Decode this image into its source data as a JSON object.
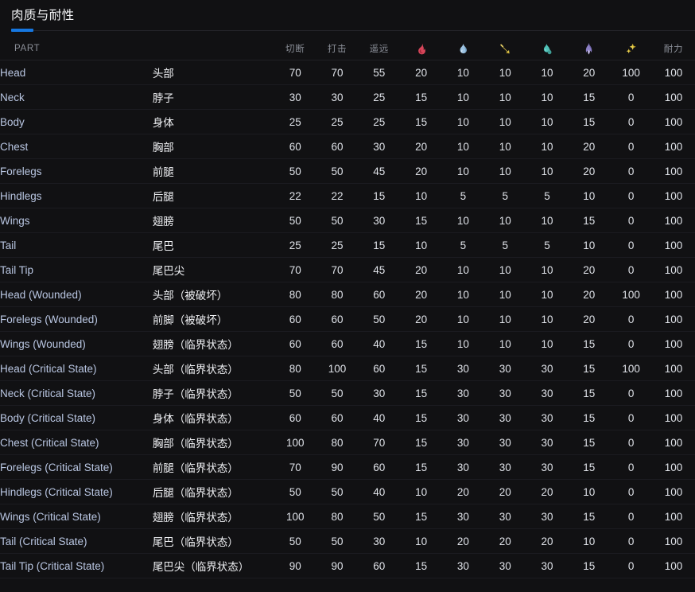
{
  "panel": {
    "title": "肉质与耐性",
    "accent_color": "#1677e0",
    "background_color": "#111113"
  },
  "table": {
    "headers": {
      "part": "PART",
      "part_cn": "",
      "sever": "切断",
      "blunt": "打击",
      "ranged": "遥远",
      "fire": "fire-icon",
      "water": "water-icon",
      "thunder": "thunder-icon",
      "ice": "ice-icon",
      "dragon": "dragon-icon",
      "blast": "blast-icon",
      "stamina": "耐力"
    },
    "element_colors": {
      "fire": "#d6465a",
      "water": "#8fb7d9",
      "thunder": "#e0c64a",
      "ice": "#4fc2b8",
      "dragon": "#8b7fc4",
      "blast": "#e8cf50"
    },
    "rows": [
      {
        "part": "Head",
        "part_cn": "头部",
        "sever": "70",
        "blunt": "70",
        "ranged": "55",
        "fire": "20",
        "water": "10",
        "thunder": "10",
        "ice": "10",
        "dragon": "20",
        "blast": "100",
        "stamina": "100"
      },
      {
        "part": "Neck",
        "part_cn": "脖子",
        "sever": "30",
        "blunt": "30",
        "ranged": "25",
        "fire": "15",
        "water": "10",
        "thunder": "10",
        "ice": "10",
        "dragon": "15",
        "blast": "0",
        "stamina": "100"
      },
      {
        "part": "Body",
        "part_cn": "身体",
        "sever": "25",
        "blunt": "25",
        "ranged": "25",
        "fire": "15",
        "water": "10",
        "thunder": "10",
        "ice": "10",
        "dragon": "15",
        "blast": "0",
        "stamina": "100"
      },
      {
        "part": "Chest",
        "part_cn": "胸部",
        "sever": "60",
        "blunt": "60",
        "ranged": "30",
        "fire": "20",
        "water": "10",
        "thunder": "10",
        "ice": "10",
        "dragon": "20",
        "blast": "0",
        "stamina": "100"
      },
      {
        "part": "Forelegs",
        "part_cn": "前腿",
        "sever": "50",
        "blunt": "50",
        "ranged": "45",
        "fire": "20",
        "water": "10",
        "thunder": "10",
        "ice": "10",
        "dragon": "20",
        "blast": "0",
        "stamina": "100"
      },
      {
        "part": "Hindlegs",
        "part_cn": "后腿",
        "sever": "22",
        "blunt": "22",
        "ranged": "15",
        "fire": "10",
        "water": "5",
        "thunder": "5",
        "ice": "5",
        "dragon": "10",
        "blast": "0",
        "stamina": "100"
      },
      {
        "part": "Wings",
        "part_cn": "翅膀",
        "sever": "50",
        "blunt": "50",
        "ranged": "30",
        "fire": "15",
        "water": "10",
        "thunder": "10",
        "ice": "10",
        "dragon": "15",
        "blast": "0",
        "stamina": "100"
      },
      {
        "part": "Tail",
        "part_cn": "尾巴",
        "sever": "25",
        "blunt": "25",
        "ranged": "15",
        "fire": "10",
        "water": "5",
        "thunder": "5",
        "ice": "5",
        "dragon": "10",
        "blast": "0",
        "stamina": "100"
      },
      {
        "part": "Tail Tip",
        "part_cn": "尾巴尖",
        "sever": "70",
        "blunt": "70",
        "ranged": "45",
        "fire": "20",
        "water": "10",
        "thunder": "10",
        "ice": "10",
        "dragon": "20",
        "blast": "0",
        "stamina": "100"
      },
      {
        "part": "Head (Wounded)",
        "part_cn": "头部（被破坏）",
        "sever": "80",
        "blunt": "80",
        "ranged": "60",
        "fire": "20",
        "water": "10",
        "thunder": "10",
        "ice": "10",
        "dragon": "20",
        "blast": "100",
        "stamina": "100"
      },
      {
        "part": "Forelegs (Wounded)",
        "part_cn": "前脚（被破坏）",
        "sever": "60",
        "blunt": "60",
        "ranged": "50",
        "fire": "20",
        "water": "10",
        "thunder": "10",
        "ice": "10",
        "dragon": "20",
        "blast": "0",
        "stamina": "100"
      },
      {
        "part": "Wings (Wounded)",
        "part_cn": "翅膀（临界状态）",
        "sever": "60",
        "blunt": "60",
        "ranged": "40",
        "fire": "15",
        "water": "10",
        "thunder": "10",
        "ice": "10",
        "dragon": "15",
        "blast": "0",
        "stamina": "100"
      },
      {
        "part": "Head (Critical State)",
        "part_cn": "头部（临界状态）",
        "sever": "80",
        "blunt": "100",
        "ranged": "60",
        "fire": "15",
        "water": "30",
        "thunder": "30",
        "ice": "30",
        "dragon": "15",
        "blast": "100",
        "stamina": "100"
      },
      {
        "part": "Neck (Critical State)",
        "part_cn": "脖子（临界状态）",
        "sever": "50",
        "blunt": "50",
        "ranged": "30",
        "fire": "15",
        "water": "30",
        "thunder": "30",
        "ice": "30",
        "dragon": "15",
        "blast": "0",
        "stamina": "100"
      },
      {
        "part": "Body (Critical State)",
        "part_cn": "身体（临界状态）",
        "sever": "60",
        "blunt": "60",
        "ranged": "40",
        "fire": "15",
        "water": "30",
        "thunder": "30",
        "ice": "30",
        "dragon": "15",
        "blast": "0",
        "stamina": "100"
      },
      {
        "part": "Chest (Critical State)",
        "part_cn": "胸部（临界状态）",
        "sever": "100",
        "blunt": "80",
        "ranged": "70",
        "fire": "15",
        "water": "30",
        "thunder": "30",
        "ice": "30",
        "dragon": "15",
        "blast": "0",
        "stamina": "100"
      },
      {
        "part": "Forelegs (Critical State)",
        "part_cn": "前腿（临界状态）",
        "sever": "70",
        "blunt": "90",
        "ranged": "60",
        "fire": "15",
        "water": "30",
        "thunder": "30",
        "ice": "30",
        "dragon": "15",
        "blast": "0",
        "stamina": "100"
      },
      {
        "part": "Hindlegs (Critical State)",
        "part_cn": "后腿（临界状态）",
        "sever": "50",
        "blunt": "50",
        "ranged": "40",
        "fire": "10",
        "water": "20",
        "thunder": "20",
        "ice": "20",
        "dragon": "10",
        "blast": "0",
        "stamina": "100"
      },
      {
        "part": "Wings (Critical State)",
        "part_cn": "翅膀（临界状态）",
        "sever": "100",
        "blunt": "80",
        "ranged": "50",
        "fire": "15",
        "water": "30",
        "thunder": "30",
        "ice": "30",
        "dragon": "15",
        "blast": "0",
        "stamina": "100"
      },
      {
        "part": "Tail (Critical State)",
        "part_cn": "尾巴（临界状态）",
        "sever": "50",
        "blunt": "50",
        "ranged": "30",
        "fire": "10",
        "water": "20",
        "thunder": "20",
        "ice": "20",
        "dragon": "10",
        "blast": "0",
        "stamina": "100"
      },
      {
        "part": "Tail Tip (Critical State)",
        "part_cn": "尾巴尖（临界状态）",
        "sever": "90",
        "blunt": "90",
        "ranged": "60",
        "fire": "15",
        "water": "30",
        "thunder": "30",
        "ice": "30",
        "dragon": "15",
        "blast": "0",
        "stamina": "100"
      }
    ]
  }
}
